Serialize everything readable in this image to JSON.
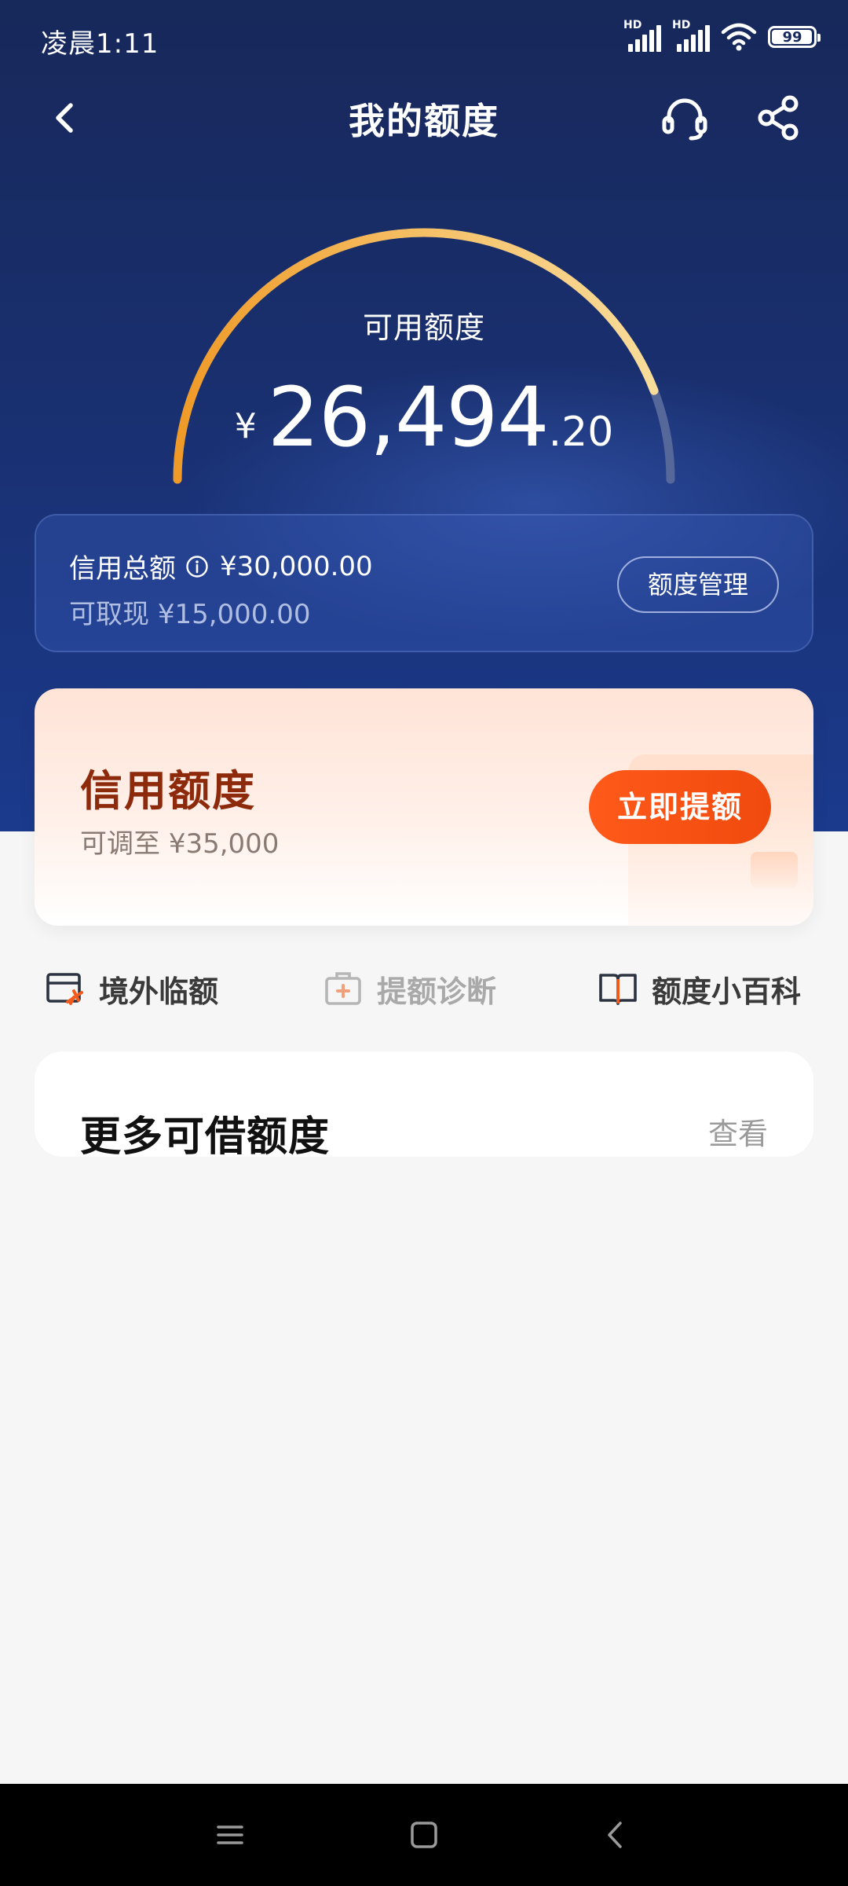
{
  "status_bar": {
    "time": "凌晨1:11",
    "signal_1_label": "HD",
    "signal_2_label": "HD",
    "battery_level": "99"
  },
  "nav": {
    "title": "我的额度"
  },
  "gauge": {
    "label": "可用额度",
    "currency": "¥",
    "amount_integer": "26,494",
    "amount_decimal": ".20",
    "used_fraction": 0.117
  },
  "summary": {
    "total_label": "信用总额",
    "total_value": "¥30,000.00",
    "cash_label": "可取现",
    "cash_value": "¥15,000.00",
    "manage_button": "额度管理"
  },
  "credit_promo": {
    "title": "信用额度",
    "subtitle_prefix": "可调至",
    "subtitle_value": "¥35,000",
    "button": "立即提额"
  },
  "quick_links": [
    {
      "label": "境外临额",
      "icon": "card-plane-icon"
    },
    {
      "label": "提额诊断",
      "icon": "medical-kit-icon"
    },
    {
      "label": "额度小百科",
      "icon": "book-icon"
    }
  ],
  "more_section": {
    "title": "更多可借额度",
    "link": "查看"
  },
  "colors": {
    "hero_bg": "#17285a",
    "gauge_gold": "#f4c878",
    "gauge_orange": "#ef9a28",
    "accent_orange": "#ff5a1a",
    "promo_title": "#8e2a0c"
  }
}
